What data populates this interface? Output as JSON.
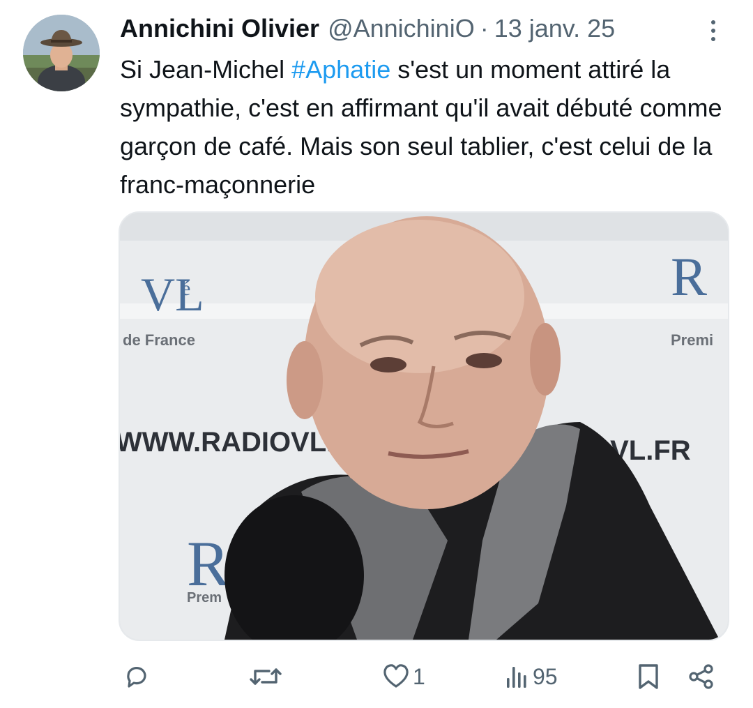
{
  "tweet": {
    "author": {
      "display_name": "Annichini Olivier",
      "handle": "@AnnichiniO",
      "avatar_icon": "user-avatar"
    },
    "separator": "·",
    "date": "13 janv. 25",
    "text": {
      "before_hashtag": "Si Jean-Michel ",
      "hashtag": "#Aphatie",
      "after_hashtag": " s'est un moment attiré la sympathie, c'est en affirmant qu'il avait débuté comme garçon de café. Mais son seul tablier, c'est celui de la franc-maçonnerie"
    },
    "media": {
      "backdrop_texts": {
        "url_left": "WWW.RADIOVL.F",
        "url_right": "OVL.FR",
        "logo_left": "VL",
        "logo_left_accent": "é",
        "logo_left_sub": "de France",
        "logo_right": "R",
        "logo_right_sub": "Premi",
        "logo_bottom": "Ra",
        "logo_bottom_sub": "Prem"
      }
    },
    "actions": {
      "reply_icon": "reply-icon",
      "retweet_icon": "retweet-icon",
      "like_icon": "heart-icon",
      "like_count": "1",
      "views_icon": "views-icon",
      "views_count": "95",
      "bookmark_icon": "bookmark-icon",
      "share_icon": "share-icon"
    }
  },
  "colors": {
    "text": "#0f1419",
    "secondary": "#536471",
    "accent": "#1d9bf0"
  }
}
